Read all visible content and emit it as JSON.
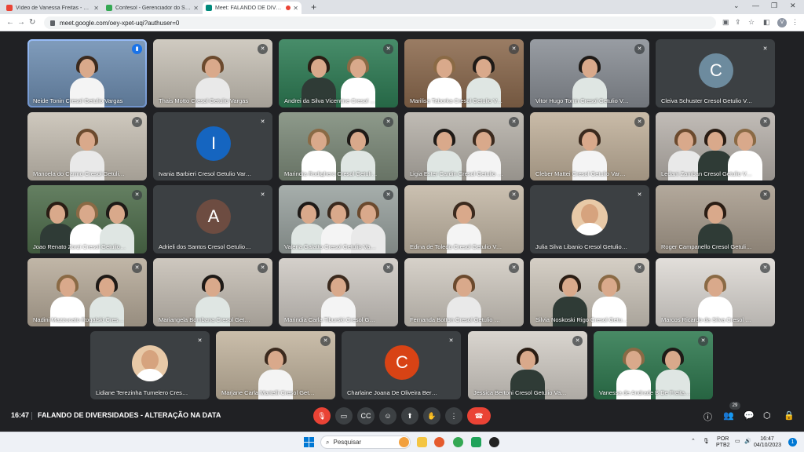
{
  "tabs": [
    {
      "title": "Vídeo de Vanessa Freitas - vanes",
      "color": "#ea4335",
      "active": false
    },
    {
      "title": "Confesol - Gerenciador do Siste",
      "color": "#34a853",
      "active": false
    },
    {
      "title": "Meet: FALANDO DE DIVERS",
      "color": "#00897b",
      "active": true
    }
  ],
  "browser": {
    "url": "meet.google.com/oey-xpet-uqi?authuser=0",
    "profile_initial": "V"
  },
  "tiles": [
    {
      "name": "Neide Tonin Cresol Getulio Vargas",
      "kind": "video",
      "bg": "#6f8fb3",
      "speaking": true,
      "people": 1
    },
    {
      "name": "Thais Motto Cresol Getulio Vargas",
      "kind": "video",
      "bg": "#c9c3b8",
      "people": 1
    },
    {
      "name": "Andrei da Silva Vicentine Cresol Getuli...",
      "kind": "video",
      "bg": "#2e7d55",
      "people": 2
    },
    {
      "name": "Marilisa Taborka Cresol Getulio Vargas",
      "kind": "video",
      "bg": "#8c6a4e",
      "people": 2
    },
    {
      "name": "Vitor Hugo Tonin Cresol Getulio Vargas",
      "kind": "video",
      "bg": "#8a8f96",
      "people": 1
    },
    {
      "name": "Cleiva Schuster Cresol Getulio Varga...",
      "kind": "letter",
      "letter": "C",
      "color": "#6d8b9e"
    },
    {
      "name": "Manoela do Carmo Cresol Getulio Var...",
      "kind": "video",
      "bg": "#c8c1b5",
      "people": 1
    },
    {
      "name": "Ivania Barbieri Cresol Getulio Vargas",
      "kind": "letter",
      "letter": "I",
      "color": "#1565c0"
    },
    {
      "name": "Marindia Rodighero Cresol Getulio Var...",
      "kind": "video",
      "bg": "#7e8c7b",
      "people": 2
    },
    {
      "name": "Ligia Ester Cardin Cresol Getulio Var...",
      "kind": "video",
      "bg": "#b7b2aa",
      "people": 2
    },
    {
      "name": "Cleber Mattei Cresol Getulio Vargas",
      "kind": "video",
      "bg": "#c2b29c",
      "people": 1
    },
    {
      "name": "Ledani Zamban Cresol Getulio Vargas",
      "kind": "video",
      "bg": "#b9b3ad",
      "people": 3
    },
    {
      "name": "Joao Renato Zorzi Cresol Getulio Var...",
      "kind": "video",
      "bg": "#4f6e4c",
      "people": 3
    },
    {
      "name": "Adrieli dos Santos Cresol Getulio Var...",
      "kind": "letter",
      "letter": "A",
      "color": "#6d4c41"
    },
    {
      "name": "Valeria Galatto Cresol Getulio Vargas",
      "kind": "video",
      "bg": "#9aa3a0",
      "people": 3
    },
    {
      "name": "Edina de Toledo Cresol Getulio Vargas",
      "kind": "video",
      "bg": "#c4b8a6",
      "people": 1
    },
    {
      "name": "Julia Silva Libanio Cresol Getulio Var...",
      "kind": "photo"
    },
    {
      "name": "Roger Campanello Cresol Getulio Var...",
      "kind": "video",
      "bg": "#a99d8e",
      "people": 1
    },
    {
      "name": "Nadini Mazzucato Rogalski Cresol G...",
      "kind": "video",
      "bg": "#b8ac9b",
      "people": 2
    },
    {
      "name": "Mariangela Bombana Cresol Getulio ...",
      "kind": "video",
      "bg": "#c7c0b6",
      "people": 1
    },
    {
      "name": "Marindia Carla Tiburski Cresol Getuli...",
      "kind": "video",
      "bg": "#cfcac4",
      "people": 1
    },
    {
      "name": "Fernanda Botton Cresol Getulio Vargas",
      "kind": "video",
      "bg": "#d1cbc2",
      "people": 1
    },
    {
      "name": "Silvia Noskoski Rigo Cresol Getulio V...",
      "kind": "video",
      "bg": "#cfc8bd",
      "people": 2
    },
    {
      "name": "Marcos Ricardo da Silva Cresol Getul...",
      "kind": "video",
      "bg": "#dedad5",
      "people": 1
    },
    {
      "name": "Lidiane Terezinha Tumelero Cresol G...",
      "kind": "photo"
    },
    {
      "name": "Marjane Carla Martelli Cresol Getuli...",
      "kind": "video",
      "bg": "#c3b59f",
      "people": 1
    },
    {
      "name": "Charlaine Joana De Oliveira Bernieri ...",
      "kind": "letter",
      "letter": "C",
      "color": "#d84315"
    },
    {
      "name": "Jessica Bertoni Cresol Getulio Varga...",
      "kind": "video",
      "bg": "#d4cfc8",
      "people": 1
    },
    {
      "name": "Vanessa de Andrade B De Freitas Cres...",
      "kind": "video",
      "bg": "#2f7a50",
      "people": 2
    }
  ],
  "meeting": {
    "time": "16:47",
    "title": "FALANDO DE DIVERSIDADES - ALTERAÇÃO NA DATA",
    "participants": "29"
  },
  "taskbar": {
    "search": "Pesquisar",
    "lang1": "POR",
    "lang2": "PTB2",
    "clock_time": "16:47",
    "clock_date": "04/10/2023",
    "notif": "1"
  }
}
